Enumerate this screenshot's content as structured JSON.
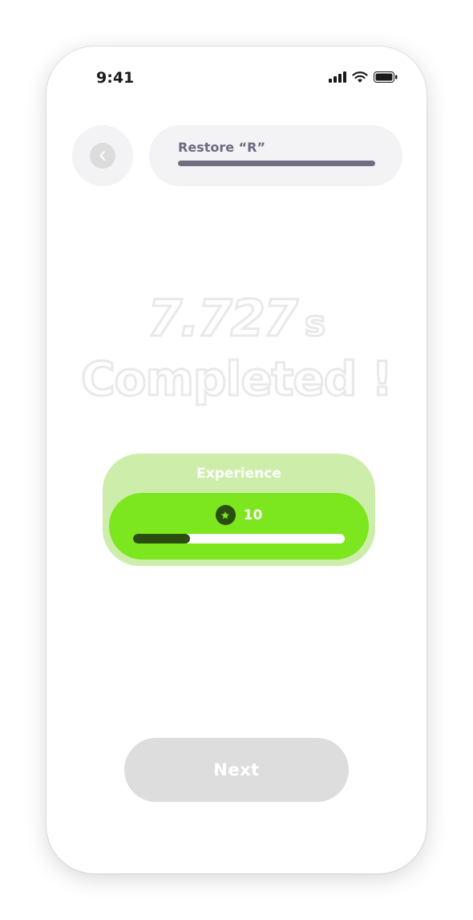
{
  "status_bar": {
    "time": "9:41",
    "icons": [
      "cellular-signal-icon",
      "wifi-icon",
      "battery-icon"
    ]
  },
  "header": {
    "back_icon": "chevron-left-icon",
    "task_title": "Restore “R”"
  },
  "result": {
    "time_value": "7.727",
    "time_unit": "s",
    "status": "Completed !"
  },
  "experience": {
    "label": "Experience",
    "icon": "star-icon",
    "value": "10",
    "progress_fraction": 0.27
  },
  "footer": {
    "next_label": "Next"
  },
  "colors": {
    "card_light": "#cdeeaa",
    "card_green": "#7ce61e",
    "dark_green": "#2a4d10",
    "pill_bg": "#f3f3f5",
    "pill_text": "#6c6b80",
    "button_disabled": "#dddddd"
  }
}
